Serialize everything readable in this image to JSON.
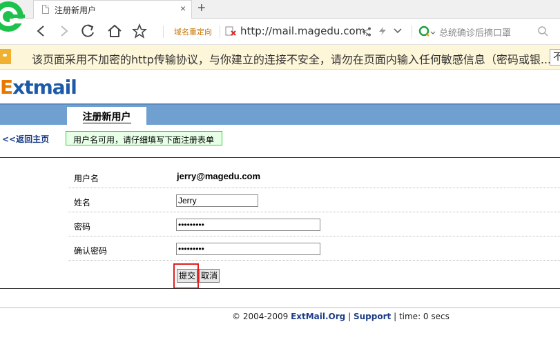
{
  "browser": {
    "tab_title": "注册新用户",
    "tab_close": "×",
    "new_tab": "+",
    "redirect_label": "域名重定向",
    "address": "http://mail.magedu.com,",
    "search_placeholder": "总统确诊后摘口罩",
    "security_notice": "该页面采用不加密的http传输协议，与你建立的连接不安全，请勿在页面内输入任何敏感信息（密码或银...",
    "security_button": "不"
  },
  "page": {
    "logo_e": "E",
    "logo_rest": "xtmail",
    "tab_label": "注册新用户",
    "back_link": "<<返回主页",
    "notice": "用户名可用，请仔细填写下面注册表单"
  },
  "form": {
    "username_label": "用户名",
    "username_value": "jerry@magedu.com",
    "name_label": "姓名",
    "name_value": "Jerry",
    "password_label": "密码",
    "password_value": "•••••••••",
    "confirm_label": "确认密码",
    "confirm_value": "•••••••••",
    "submit_label": "提交",
    "cancel_label": "取消"
  },
  "footer": {
    "copyright": "© 2004-2009",
    "extmail_link": "ExtMail.Org",
    "sep1": "|",
    "support_link": "Support",
    "sep2": "|",
    "time": "time: 0 secs"
  },
  "colors": {
    "band": "#6fa0d0",
    "notice_bg": "#e6ffe6",
    "notice_border": "#33cc33",
    "highlight": "#e02020",
    "security_bg": "#fdf6d8"
  }
}
